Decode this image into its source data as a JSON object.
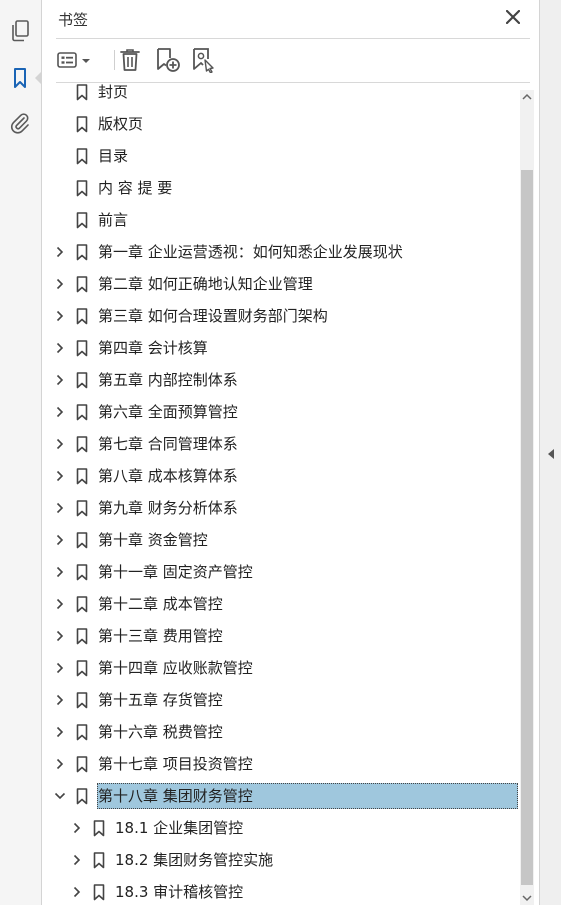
{
  "panel": {
    "title": "书签",
    "close_label": "×"
  },
  "rail": {
    "items": [
      {
        "name": "pages-icon"
      },
      {
        "name": "bookmark-icon",
        "active": true
      },
      {
        "name": "attachment-icon"
      }
    ]
  },
  "toolbar": {
    "buttons": [
      "options-menu-icon",
      "delete-bookmark-icon",
      "new-bookmark-icon",
      "new-bookmark-from-structure-icon"
    ]
  },
  "bookmarks": [
    {
      "label": "封页",
      "expandable": false,
      "expanded": false,
      "level": 0
    },
    {
      "label": "版权页",
      "expandable": false,
      "expanded": false,
      "level": 0
    },
    {
      "label": "目录",
      "expandable": false,
      "expanded": false,
      "level": 0
    },
    {
      "label": "内 容 提 要",
      "expandable": false,
      "expanded": false,
      "level": 0
    },
    {
      "label": "前言",
      "expandable": false,
      "expanded": false,
      "level": 0
    },
    {
      "label": "第一章 企业运营透视：如何知悉企业发展现状",
      "expandable": true,
      "expanded": false,
      "level": 0
    },
    {
      "label": "第二章 如何正确地认知企业管理",
      "expandable": true,
      "expanded": false,
      "level": 0
    },
    {
      "label": "第三章 如何合理设置财务部门架构",
      "expandable": true,
      "expanded": false,
      "level": 0
    },
    {
      "label": "第四章 会计核算",
      "expandable": true,
      "expanded": false,
      "level": 0
    },
    {
      "label": "第五章 内部控制体系",
      "expandable": true,
      "expanded": false,
      "level": 0
    },
    {
      "label": "第六章 全面预算管控",
      "expandable": true,
      "expanded": false,
      "level": 0
    },
    {
      "label": "第七章 合同管理体系",
      "expandable": true,
      "expanded": false,
      "level": 0
    },
    {
      "label": "第八章 成本核算体系",
      "expandable": true,
      "expanded": false,
      "level": 0
    },
    {
      "label": "第九章 财务分析体系",
      "expandable": true,
      "expanded": false,
      "level": 0
    },
    {
      "label": "第十章 资金管控",
      "expandable": true,
      "expanded": false,
      "level": 0
    },
    {
      "label": "第十一章 固定资产管控",
      "expandable": true,
      "expanded": false,
      "level": 0
    },
    {
      "label": "第十二章 成本管控",
      "expandable": true,
      "expanded": false,
      "level": 0
    },
    {
      "label": "第十三章 费用管控",
      "expandable": true,
      "expanded": false,
      "level": 0
    },
    {
      "label": "第十四章 应收账款管控",
      "expandable": true,
      "expanded": false,
      "level": 0
    },
    {
      "label": "第十五章 存货管控",
      "expandable": true,
      "expanded": false,
      "level": 0
    },
    {
      "label": "第十六章 税费管控",
      "expandable": true,
      "expanded": false,
      "level": 0
    },
    {
      "label": "第十七章 项目投资管控",
      "expandable": true,
      "expanded": false,
      "level": 0
    },
    {
      "label": "第十八章 集团财务管控",
      "expandable": true,
      "expanded": true,
      "level": 0,
      "selected": true
    },
    {
      "label": "18.1 企业集团管控",
      "expandable": true,
      "expanded": false,
      "level": 1
    },
    {
      "label": "18.2 集团财务管控实施",
      "expandable": true,
      "expanded": false,
      "level": 1
    },
    {
      "label": "18.3 审计稽核管控",
      "expandable": true,
      "expanded": false,
      "level": 1
    }
  ],
  "colors": {
    "selection": "#9fc7dd",
    "rail_active": "#1a64b5",
    "icon_gray": "#5a5a5a"
  }
}
